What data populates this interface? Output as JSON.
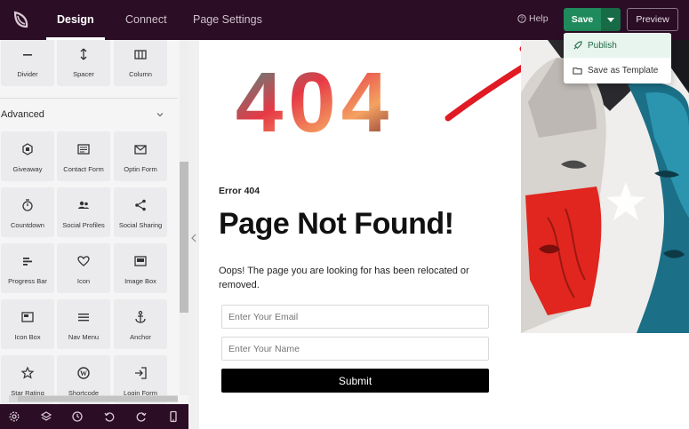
{
  "topbar": {
    "tabs": [
      {
        "label": "Design",
        "active": true
      },
      {
        "label": "Connect",
        "active": false
      },
      {
        "label": "Page Settings",
        "active": false
      }
    ],
    "help_label": "Help",
    "save_label": "Save",
    "preview_label": "Preview"
  },
  "save_menu": {
    "items": [
      {
        "label": "Publish",
        "icon": "rocket-icon"
      },
      {
        "label": "Save as Template",
        "icon": "folder-icon"
      }
    ]
  },
  "sidebar": {
    "top_blocks": [
      {
        "label": "Divider",
        "icon": "divider-icon"
      },
      {
        "label": "Spacer",
        "icon": "spacer-icon"
      },
      {
        "label": "Column",
        "icon": "column-icon"
      }
    ],
    "section_title": "Advanced",
    "blocks": [
      {
        "label": "Giveaway",
        "icon": "trophy-icon"
      },
      {
        "label": "Contact Form",
        "icon": "contact-form-icon"
      },
      {
        "label": "Optin Form",
        "icon": "envelope-icon"
      },
      {
        "label": "Countdown",
        "icon": "stopwatch-icon"
      },
      {
        "label": "Social Profiles",
        "icon": "users-icon"
      },
      {
        "label": "Social Sharing",
        "icon": "share-icon"
      },
      {
        "label": "Progress Bar",
        "icon": "progress-bar-icon"
      },
      {
        "label": "Icon",
        "icon": "heart-icon"
      },
      {
        "label": "Image Box",
        "icon": "image-box-icon"
      },
      {
        "label": "Icon Box",
        "icon": "icon-box-icon"
      },
      {
        "label": "Nav Menu",
        "icon": "menu-icon"
      },
      {
        "label": "Anchor",
        "icon": "anchor-icon"
      },
      {
        "label": "Star Rating",
        "icon": "star-icon"
      },
      {
        "label": "Shortcode",
        "icon": "wordpress-icon"
      },
      {
        "label": "Login Form",
        "icon": "login-icon"
      }
    ]
  },
  "canvas": {
    "big_404": "404",
    "error_label": "Error 404",
    "headline": "Page Not Found!",
    "description": "Oops! The page you are looking for has been relocated or removed.",
    "email_placeholder": "Enter Your Email",
    "name_placeholder": "Enter Your Name",
    "submit_label": "Submit"
  },
  "colors": {
    "topbar_bg": "#2b0d25",
    "save_green": "#1f8a5b",
    "annotation_arrow": "#e01b24"
  }
}
